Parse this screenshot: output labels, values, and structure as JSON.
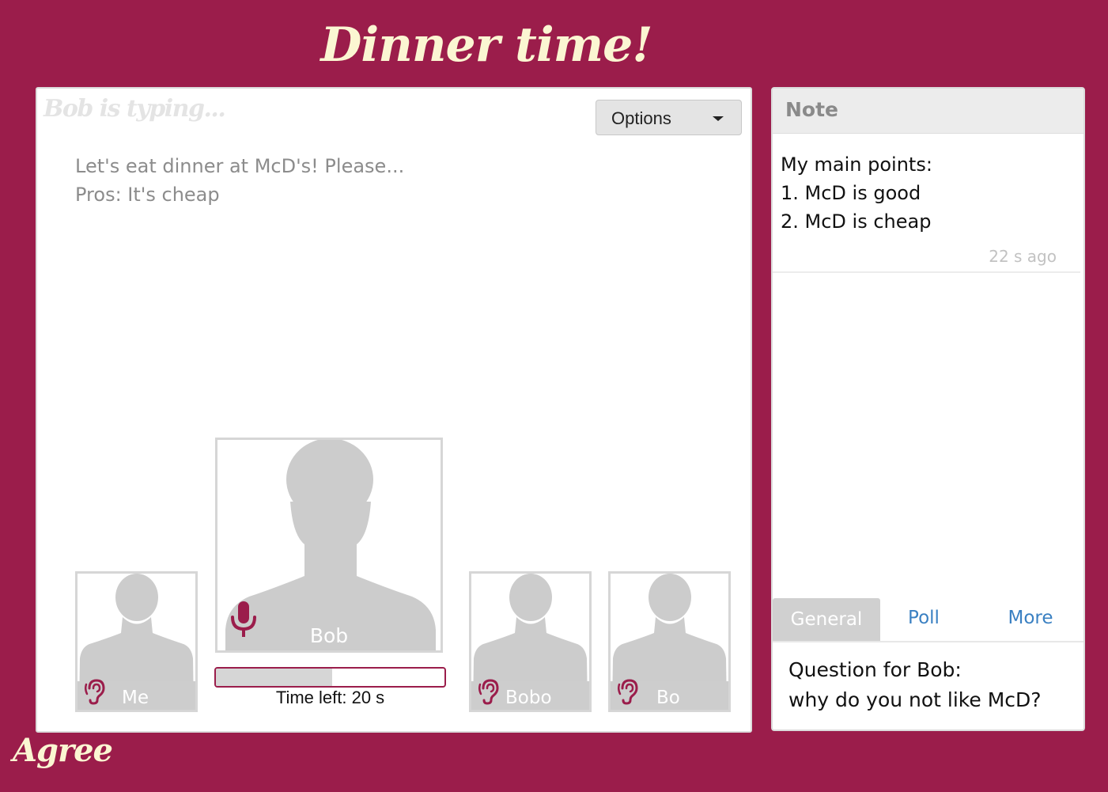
{
  "page": {
    "title": "Dinner time!",
    "agree_label": "Agree"
  },
  "main": {
    "typing_status": "Bob is typing...",
    "options_label": "Options",
    "messages": [
      "Let's eat dinner at McD's! Please...",
      "Pros: It's cheap"
    ],
    "participants": {
      "me": "Me",
      "speaker": "Bob",
      "p3": "Bobo",
      "p4": "Bo"
    },
    "time_left": "Time left: 20 s",
    "time_progress_fraction": 0.51
  },
  "note": {
    "header": "Note",
    "lines": [
      "My main points:",
      "1. McD is good",
      "2. McD is cheap"
    ],
    "timestamp": "22 s ago",
    "tabs": [
      "General",
      "Poll",
      "More"
    ],
    "active_tab": "General",
    "question_lines": [
      "Question for Bob:",
      "why do you not like McD?"
    ]
  },
  "colors": {
    "background": "#9b1d4b",
    "title": "#fbf6d2",
    "accent": "#9b1d4b",
    "link": "#3a80c2",
    "silhouette": "#cccccc"
  },
  "icons": [
    "microphone-icon",
    "ear-icon",
    "caret-down-icon"
  ]
}
